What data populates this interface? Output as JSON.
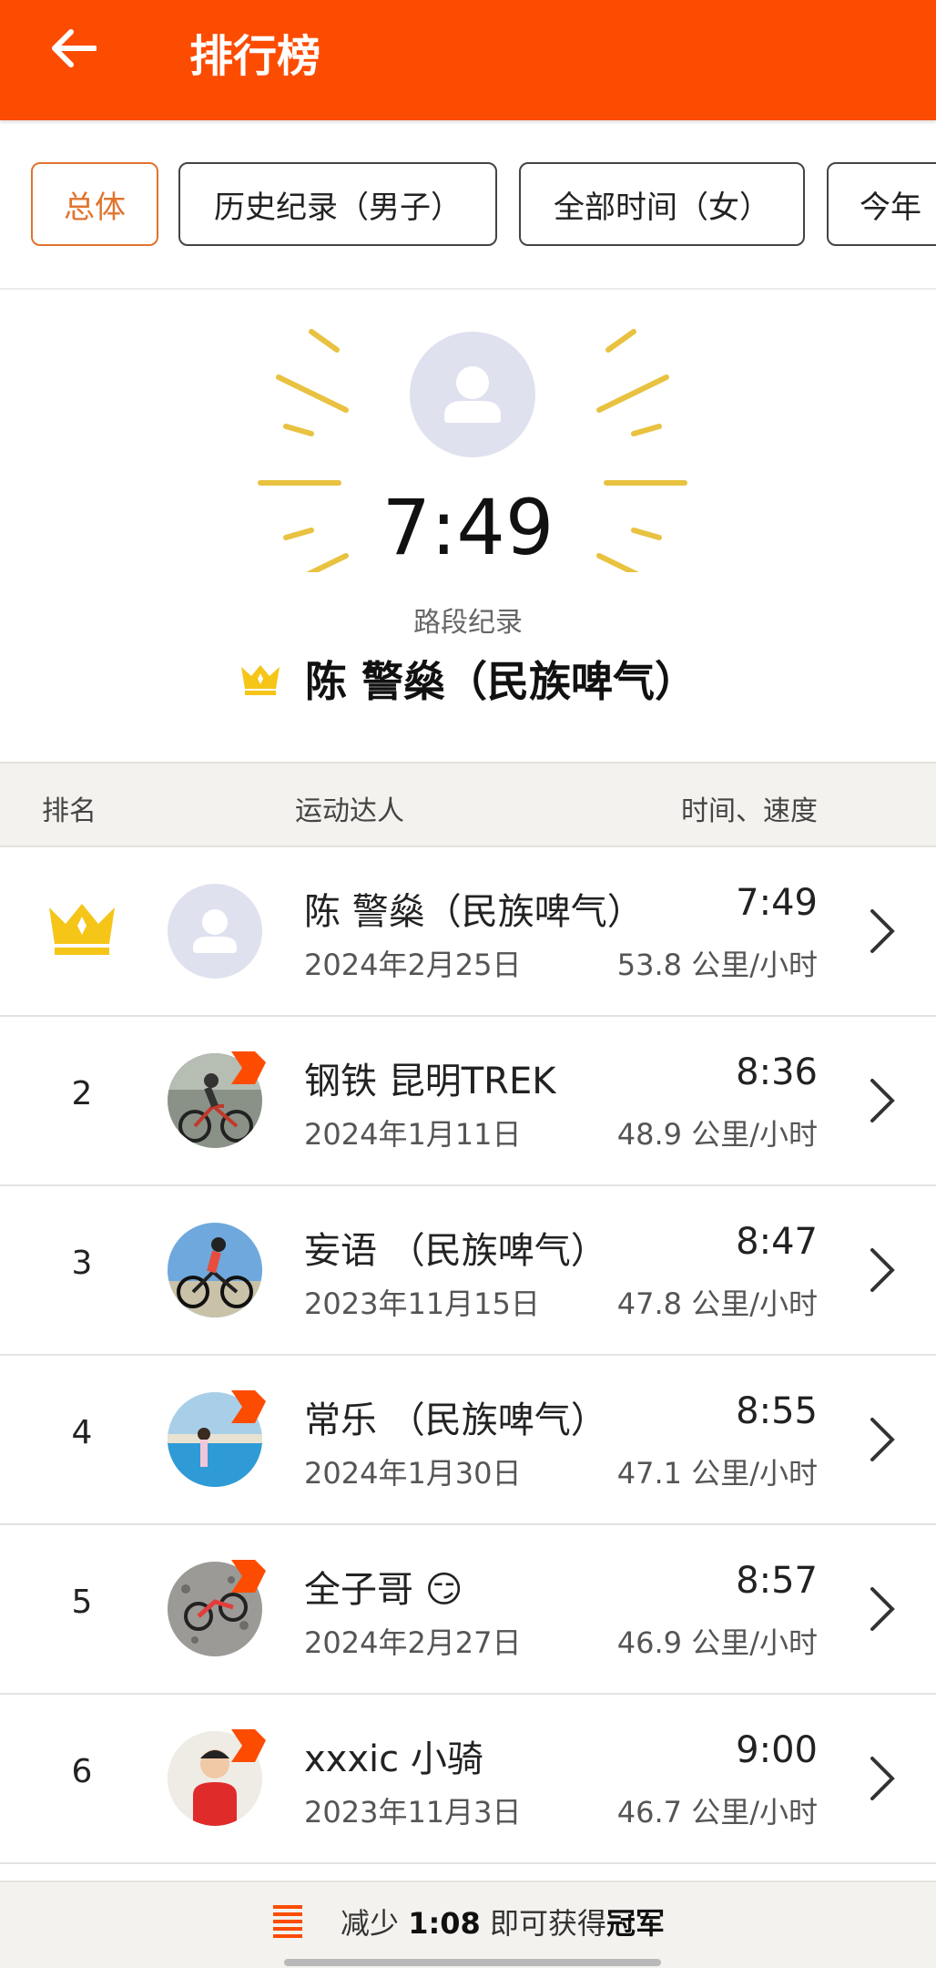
{
  "header": {
    "title": "排行榜",
    "back_icon": "arrow-left-icon"
  },
  "filters": [
    {
      "label": "总体",
      "active": true
    },
    {
      "label": "历史纪录（男子）",
      "active": false
    },
    {
      "label": "全部时间（女）",
      "active": false
    },
    {
      "label": "今年",
      "active": false
    }
  ],
  "hero": {
    "time": "7:49",
    "subtitle": "路段纪录",
    "name": "陈 警燊（民族啤气）",
    "icon": "crown-icon"
  },
  "columns": {
    "rank": "排名",
    "athlete": "运动达人",
    "time_speed": "时间、速度"
  },
  "entries": [
    {
      "rank": "1",
      "name": "陈 警燊（民族啤气）",
      "date": "2024年2月25日",
      "time": "7:49",
      "speed": "53.8 公里/小时",
      "crown": true
    },
    {
      "rank": "2",
      "name": "钢铁 昆明TREK",
      "date": "2024年1月11日",
      "time": "8:36",
      "speed": "48.9 公里/小时"
    },
    {
      "rank": "3",
      "name": "妄语 （民族啤气）",
      "date": "2023年11月15日",
      "time": "8:47",
      "speed": "47.8 公里/小时"
    },
    {
      "rank": "4",
      "name": "常乐 （民族啤气）",
      "date": "2024年1月30日",
      "time": "8:55",
      "speed": "47.1 公里/小时"
    },
    {
      "rank": "5",
      "name": "全子哥 😏",
      "date": "2024年2月27日",
      "time": "8:57",
      "speed": "46.9 公里/小时"
    },
    {
      "rank": "6",
      "name": "xxxic 小骑",
      "date": "2023年11月3日",
      "time": "9:00",
      "speed": "46.7 公里/小时"
    }
  ],
  "footer": {
    "prefix": "减少",
    "delta": "1:08",
    "middle": "即可获得",
    "goal": "冠军",
    "icon": "list-icon"
  },
  "colors": {
    "brand": "#fc4c02",
    "accent": "#e0742e",
    "crown": "#f5c518",
    "rays": "#e8c240"
  }
}
